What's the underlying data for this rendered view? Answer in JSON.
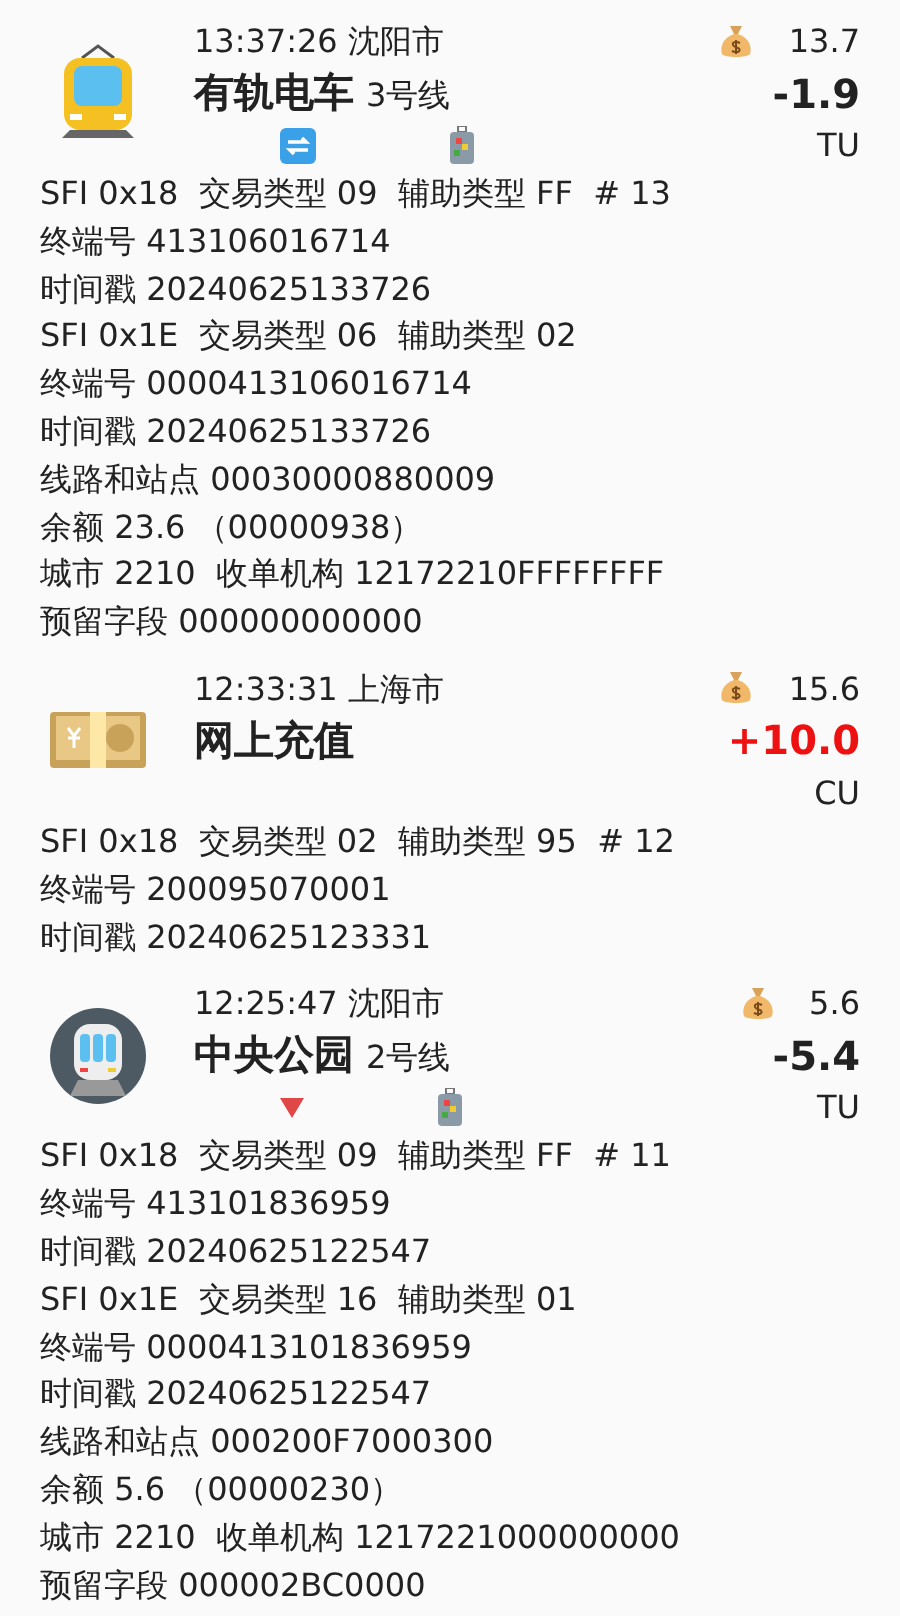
{
  "records": [
    {
      "kind": "tram",
      "time": "13:37:26",
      "city": "沈阳市",
      "title": "有轨电车",
      "line": "3号线",
      "indicators": [
        {
          "kind": "transfer"
        },
        {
          "kind": "luggage"
        }
      ],
      "balance": "13.7",
      "amount": "-1.9",
      "credit": false,
      "unit": "TU",
      "details": [
        "SFI 0x18  交易类型 09  辅助类型 FF  # 13",
        "终端号 413106016714",
        "时间戳 20240625133726",
        "SFI 0x1E  交易类型 06  辅助类型 02",
        "终端号 0000413106016714",
        "时间戳 20240625133726",
        "线路和站点 00030000880009",
        "余额 23.6 （00000938）",
        "城市 2210  收单机构 12172210FFFFFFFF",
        "预留字段 000000000000"
      ]
    },
    {
      "kind": "topup",
      "time": "12:33:31",
      "city": "上海市",
      "title": "网上充值",
      "balance": "15.6",
      "amount": "+10.0",
      "credit": true,
      "unit": "CU",
      "details": [
        "SFI 0x18  交易类型 02  辅助类型 95  # 12",
        "终端号 200095070001",
        "时间戳 20240625123331"
      ]
    },
    {
      "kind": "metro",
      "time": "12:25:47",
      "city": "沈阳市",
      "title": "中央公园",
      "line": "2号线",
      "indicators": [
        {
          "kind": "down"
        },
        {
          "kind": "luggage"
        }
      ],
      "balance": "5.6",
      "amount": "-5.4",
      "credit": false,
      "unit": "TU",
      "details": [
        "SFI 0x18  交易类型 09  辅助类型 FF  # 11",
        "终端号 413101836959",
        "时间戳 20240625122547",
        "SFI 0x1E  交易类型 16  辅助类型 01",
        "终端号 0000413101836959",
        "时间戳 20240625122547",
        "线路和站点 000200F7000300",
        "余额 5.6 （00000230）",
        "城市 2210  收单机构 1217221000000000",
        "预留字段 000002BC0000"
      ]
    }
  ]
}
